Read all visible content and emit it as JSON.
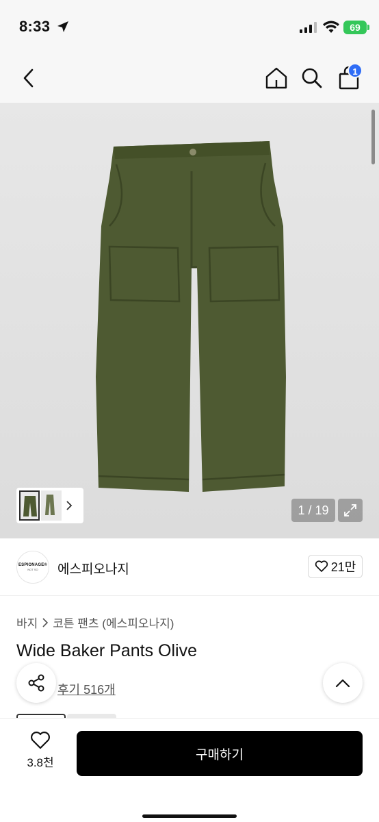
{
  "status_bar": {
    "time": "8:33",
    "battery": "69"
  },
  "header": {
    "cart_badge": "1"
  },
  "gallery": {
    "page_counter": "1 / 19",
    "pants_color": "#4e5a32"
  },
  "brand": {
    "logo_line1": "ESPIONAGE®",
    "logo_line2": "NOT SO",
    "name": "에스피오나지",
    "likes": "21만"
  },
  "product": {
    "breadcrumb": [
      "바지",
      "코튼 팬츠 (에스피오나지)"
    ],
    "title": "Wide Baker Pants Olive",
    "review_text": "후기 516개"
  },
  "bottom_bar": {
    "wish_count": "3.8천",
    "buy_label": "구매하기"
  }
}
